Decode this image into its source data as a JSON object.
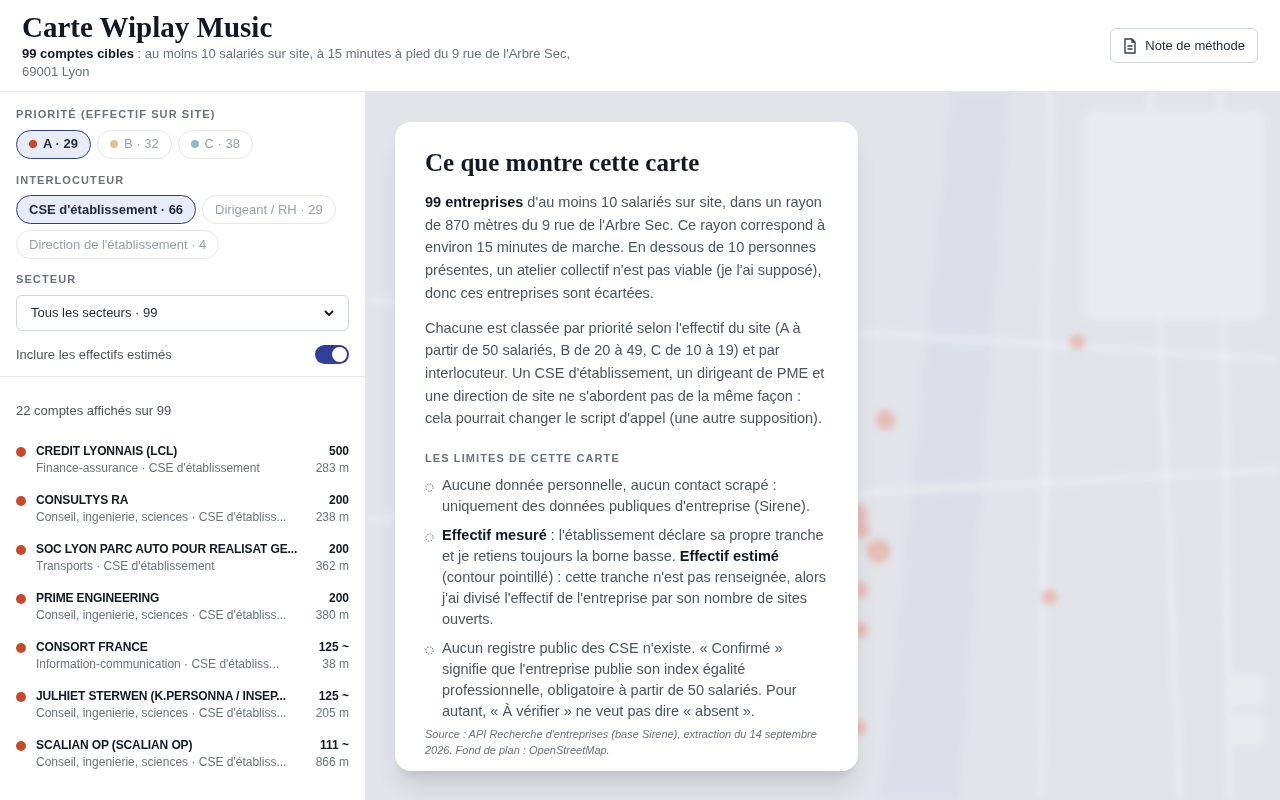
{
  "header": {
    "title": "Carte Wiplay Music",
    "subtitle": "**99 comptes cibles** : au moins 10 salariés sur site, à 15 minutes à pied du 9 rue de l'Arbre Sec, 69001 Lyon",
    "method_button": "Note de méthode"
  },
  "filters": {
    "priority": {
      "label": "PRIORITÉ (EFFECTIF SUR SITE)",
      "chips": [
        {
          "label": "A · 29",
          "color": "#c8492c",
          "selected": true
        },
        {
          "label": "B · 32",
          "color": "#e3c48e",
          "selected": false
        },
        {
          "label": "C · 38",
          "color": "#93b9c4",
          "selected": false
        }
      ]
    },
    "contact": {
      "label": "INTERLOCUTEUR",
      "chips": [
        {
          "label": "CSE d'établissement · 66",
          "selected": true
        },
        {
          "label": "Dirigeant / RH · 29",
          "selected": false
        },
        {
          "label": "Direction de l'établissement · 4",
          "selected": false
        }
      ]
    },
    "sector": {
      "label": "SECTEUR",
      "value": "Tous les secteurs · 99"
    },
    "estimated": {
      "label": "Inclure les effectifs estimés",
      "on": true
    }
  },
  "results": {
    "count": "22 comptes affichés sur 99",
    "rows": [
      {
        "name": "CREDIT LYONNAIS (LCL)",
        "detail": "Finance-assurance · CSE d'établissement",
        "staff": "500",
        "distance": "283 m",
        "color": "#c8492c"
      },
      {
        "name": "CONSULTYS RA",
        "detail": "Conseil, ingenierie, sciences · CSE d'établiss...",
        "staff": "200",
        "distance": "238 m",
        "color": "#c8492c"
      },
      {
        "name": "SOC LYON PARC AUTO POUR REALISAT GE...",
        "detail": "Transports · CSE d'établissement",
        "staff": "200",
        "distance": "362 m",
        "color": "#c8492c"
      },
      {
        "name": "PRIME ENGINEERING",
        "detail": "Conseil, ingenierie, sciences · CSE d'établiss...",
        "staff": "200",
        "distance": "380 m",
        "color": "#c8492c"
      },
      {
        "name": "CONSORT FRANCE",
        "detail": "Information-communication · CSE d'établiss...",
        "staff": "125 ~",
        "distance": "38 m",
        "color": "#c8492c"
      },
      {
        "name": "JULHIET STERWEN (K.PERSONNA / INSEP...",
        "detail": "Conseil, ingenierie, sciences · CSE d'établiss...",
        "staff": "125 ~",
        "distance": "205 m",
        "color": "#c8492c"
      },
      {
        "name": "SCALIAN OP (SCALIAN OP)",
        "detail": "Conseil, ingenierie, sciences · CSE d'établiss...",
        "staff": "111 ~",
        "distance": "866 m",
        "color": "#c8492c"
      }
    ]
  },
  "dialog": {
    "title": "Ce que montre cette carte",
    "paragraphs": [
      "**99 entreprises** d'au moins 10 salariés sur site, dans un rayon de 870 mètres du 9 rue de l'Arbre Sec. Ce rayon correspond à environ 15 minutes de marche. En dessous de 10 personnes présentes, un atelier collectif n'est pas viable (je l'ai supposé), donc ces entreprises sont écartées.",
      "Chacune est classée par priorité selon l'effectif du site (A à partir de 50 salariés, B de 20 à 49, C de 10 à 19) et par interlocuteur. Un CSE d'établissement, un dirigeant de PME et une direction de site ne s'abordent pas de la même façon : cela pourrait changer le script d'appel (une autre supposition)."
    ],
    "limits_title": "LES LIMITES DE CETTE CARTE",
    "limits": [
      "Aucune donnée personnelle, aucun contact scrapé : uniquement des données publiques d'entreprise (Sirene).",
      "**Effectif mesuré** : l'établissement déclare sa propre tranche et je retiens toujours la borne basse. **Effectif estimé** (contour pointillé) : cette tranche n'est pas renseignée, alors j'ai divisé l'effectif de l'entreprise par son nombre de sites ouverts.",
      "Aucun registre public des CSE n'existe. « Confirmé » signifie que l'entreprise publie son index égalité professionnelle, obligatoire à partir de 50 salariés. Pour autant, « À vérifier » ne veut pas dire « absent »."
    ],
    "source": "Source : API Recherche d'entreprises (base Sirene), extraction du 14 septembre 2026. Fond de plan : OpenStreetMap."
  }
}
